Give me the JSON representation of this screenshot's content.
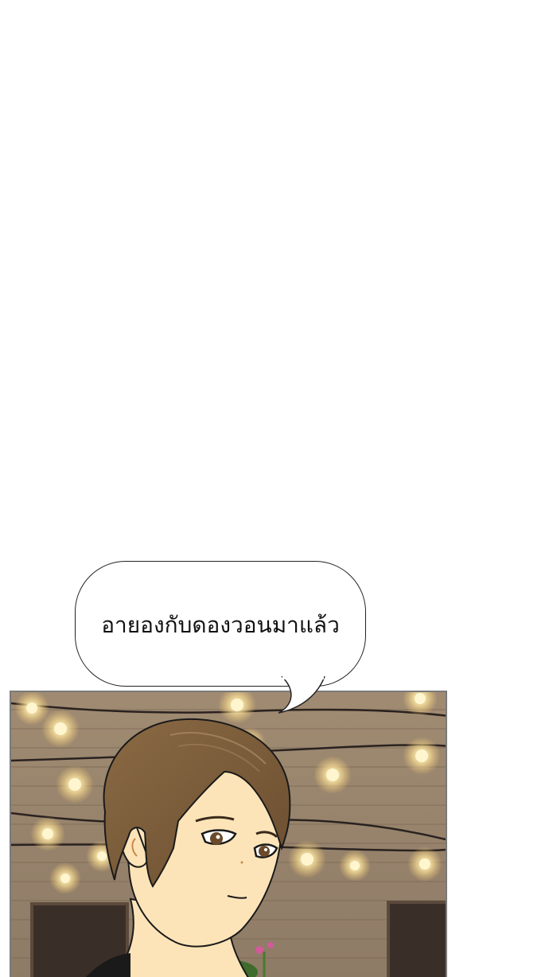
{
  "speech_bubble": {
    "text": "อายองกับดองวอนมาแล้ว"
  },
  "panel": {
    "scene": "night-cafe-with-string-lights",
    "background_colors": {
      "wall": "#9a8670",
      "brick_dark": "#7d6a55",
      "light_glow": "#fff2b8",
      "hair": "#7a5a38",
      "skin": "#fce4b8",
      "panel_border": "#7a7a7a"
    }
  }
}
